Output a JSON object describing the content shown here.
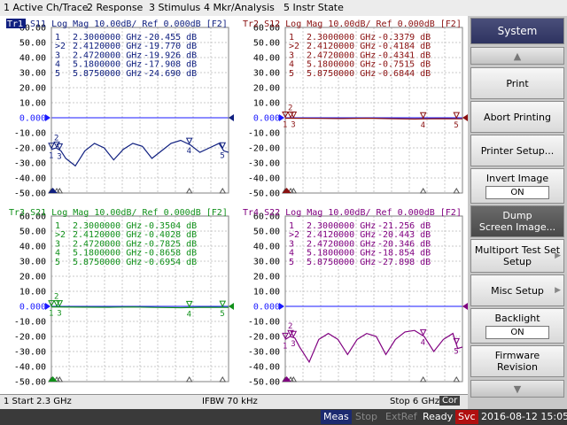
{
  "menu": [
    "1 Active Ch/Trace",
    "2 Response",
    "3 Stimulus",
    "4 Mkr/Analysis",
    "5 Instr State"
  ],
  "colors": {
    "tr1": "#102080",
    "tr2": "#8a1010",
    "tr3": "#10901a",
    "tr4": "#800080",
    "refline": "#1a1aff"
  },
  "y_ticks": [
    "60.00",
    "50.00",
    "40.00",
    "30.00",
    "20.00",
    "10.00",
    "0.000",
    "-10.00",
    "-20.00",
    "-30.00",
    "-40.00",
    "-50.00"
  ],
  "traces": [
    {
      "id": "tr1",
      "badge": "Tr1",
      "label": "S11 Log Mag 10.00dB/ Ref 0.000dB [F2]",
      "color": "#102080",
      "markers": [
        [
          "1",
          "2.3000000 GHz",
          "-20.455 dB"
        ],
        [
          ">2",
          "2.4120000 GHz",
          "-19.770 dB"
        ],
        [
          "3",
          "2.4720000 GHz",
          "-19.926 dB"
        ],
        [
          "4",
          "5.1800000 GHz",
          "-17.908 dB"
        ],
        [
          "5",
          "5.8750000 GHz",
          "-24.690 dB"
        ]
      ]
    },
    {
      "id": "tr2",
      "badge": "",
      "label": "Tr2 S12 Log Mag 10.00dB/ Ref 0.000dB [F2]",
      "color": "#8a1010",
      "markers": [
        [
          "1",
          "2.3000000 GHz",
          "-0.3379 dB"
        ],
        [
          ">2",
          "2.4120000 GHz",
          "-0.4184 dB"
        ],
        [
          "3",
          "2.4720000 GHz",
          "-0.4341 dB"
        ],
        [
          "4",
          "5.1800000 GHz",
          "-0.7515 dB"
        ],
        [
          "5",
          "5.8750000 GHz",
          "-0.6844 dB"
        ]
      ]
    },
    {
      "id": "tr3",
      "badge": "",
      "label": "Tr3 S21 Log Mag 10.00dB/ Ref 0.000dB [F2]",
      "color": "#10901a",
      "markers": [
        [
          "1",
          "2.3000000 GHz",
          "-0.3504 dB"
        ],
        [
          ">2",
          "2.4120000 GHz",
          "-0.4028 dB"
        ],
        [
          "3",
          "2.4720000 GHz",
          "-0.7825 dB"
        ],
        [
          "4",
          "5.1800000 GHz",
          "-0.8658 dB"
        ],
        [
          "5",
          "5.8750000 GHz",
          "-0.6954 dB"
        ]
      ]
    },
    {
      "id": "tr4",
      "badge": "",
      "label": "Tr4 S22 Log Mag 10.00dB/ Ref 0.000dB [F2]",
      "color": "#800080",
      "markers": [
        [
          "1",
          "2.3000000 GHz",
          "-21.256 dB"
        ],
        [
          ">2",
          "2.4120000 GHz",
          "-20.443 dB"
        ],
        [
          "3",
          "2.4720000 GHz",
          "-20.346 dB"
        ],
        [
          "4",
          "5.1800000 GHz",
          "-18.854 dB"
        ],
        [
          "5",
          "5.8750000 GHz",
          "-27.898 dB"
        ]
      ]
    }
  ],
  "chart_data": [
    {
      "type": "line",
      "title": "Tr1 S11 Log Mag 10.00dB/ Ref 0.000dB [F2]",
      "ylim": [
        -50,
        60
      ],
      "xlim_ghz": [
        2.3,
        6
      ],
      "x": [
        2.3,
        2.4,
        2.5,
        2.6,
        2.8,
        3.0,
        3.2,
        3.4,
        3.6,
        3.8,
        4.0,
        4.2,
        4.4,
        4.6,
        4.8,
        5.0,
        5.2,
        5.4,
        5.6,
        5.8,
        5.9,
        6.0
      ],
      "y": [
        -21,
        -20,
        -22,
        -27,
        -32,
        -22,
        -17,
        -20,
        -28,
        -21,
        -17,
        -19,
        -27,
        -22,
        -17,
        -15,
        -18,
        -23,
        -20,
        -17,
        -22,
        -23
      ]
    },
    {
      "type": "line",
      "title": "Tr2 S12 Log Mag 10.00dB/ Ref 0.000dB [F2]",
      "ylim": [
        -50,
        60
      ],
      "xlim_ghz": [
        2.3,
        6
      ],
      "x": [
        2.3,
        3.0,
        3.5,
        4.0,
        4.5,
        5.0,
        5.5,
        6.0
      ],
      "y": [
        -0.3,
        -0.4,
        -0.5,
        -0.3,
        -0.6,
        -0.8,
        -0.6,
        -0.7
      ]
    },
    {
      "type": "line",
      "title": "Tr3 S21 Log Mag 10.00dB/ Ref 0.000dB [F2]",
      "ylim": [
        -50,
        60
      ],
      "xlim_ghz": [
        2.3,
        6
      ],
      "x": [
        2.3,
        3.0,
        3.5,
        4.0,
        4.5,
        5.0,
        5.5,
        6.0
      ],
      "y": [
        -0.35,
        -0.5,
        -0.6,
        -0.4,
        -0.7,
        -0.9,
        -0.6,
        -0.7
      ]
    },
    {
      "type": "line",
      "title": "Tr4 S22 Log Mag 10.00dB/ Ref 0.000dB [F2]",
      "ylim": [
        -50,
        60
      ],
      "xlim_ghz": [
        2.3,
        6
      ],
      "x": [
        2.3,
        2.4,
        2.5,
        2.6,
        2.8,
        3.0,
        3.2,
        3.4,
        3.6,
        3.8,
        4.0,
        4.2,
        4.4,
        4.6,
        4.8,
        5.0,
        5.2,
        5.4,
        5.6,
        5.8,
        5.9,
        6.0
      ],
      "y": [
        -22,
        -20,
        -21,
        -27,
        -37,
        -22,
        -18,
        -22,
        -32,
        -22,
        -18,
        -20,
        -32,
        -22,
        -17,
        -16,
        -20,
        -30,
        -22,
        -18,
        -28,
        -27
      ]
    }
  ],
  "bottom": {
    "start": "1  Start 2.3 GHz",
    "ifbw": "IFBW 70 kHz",
    "stop": "Stop 6 GHz",
    "cor": "Cor"
  },
  "status": {
    "meas": "Meas",
    "stop": "Stop",
    "extref": "ExtRef",
    "ready": "Ready",
    "svc": "Svc",
    "datetime": "2016-08-12 15:05"
  },
  "softkeys": {
    "system": "System",
    "print": "Print",
    "abort": "Abort Printing",
    "printer_setup": "Printer Setup...",
    "invert_image": "Invert Image",
    "invert_value": "ON",
    "dump1": "Dump",
    "dump2": "Screen Image...",
    "multiport1": "Multiport Test Set",
    "multiport2": "Setup",
    "misc": "Misc Setup",
    "backlight": "Backlight",
    "backlight_value": "ON",
    "firmware1": "Firmware",
    "firmware2": "Revision"
  }
}
